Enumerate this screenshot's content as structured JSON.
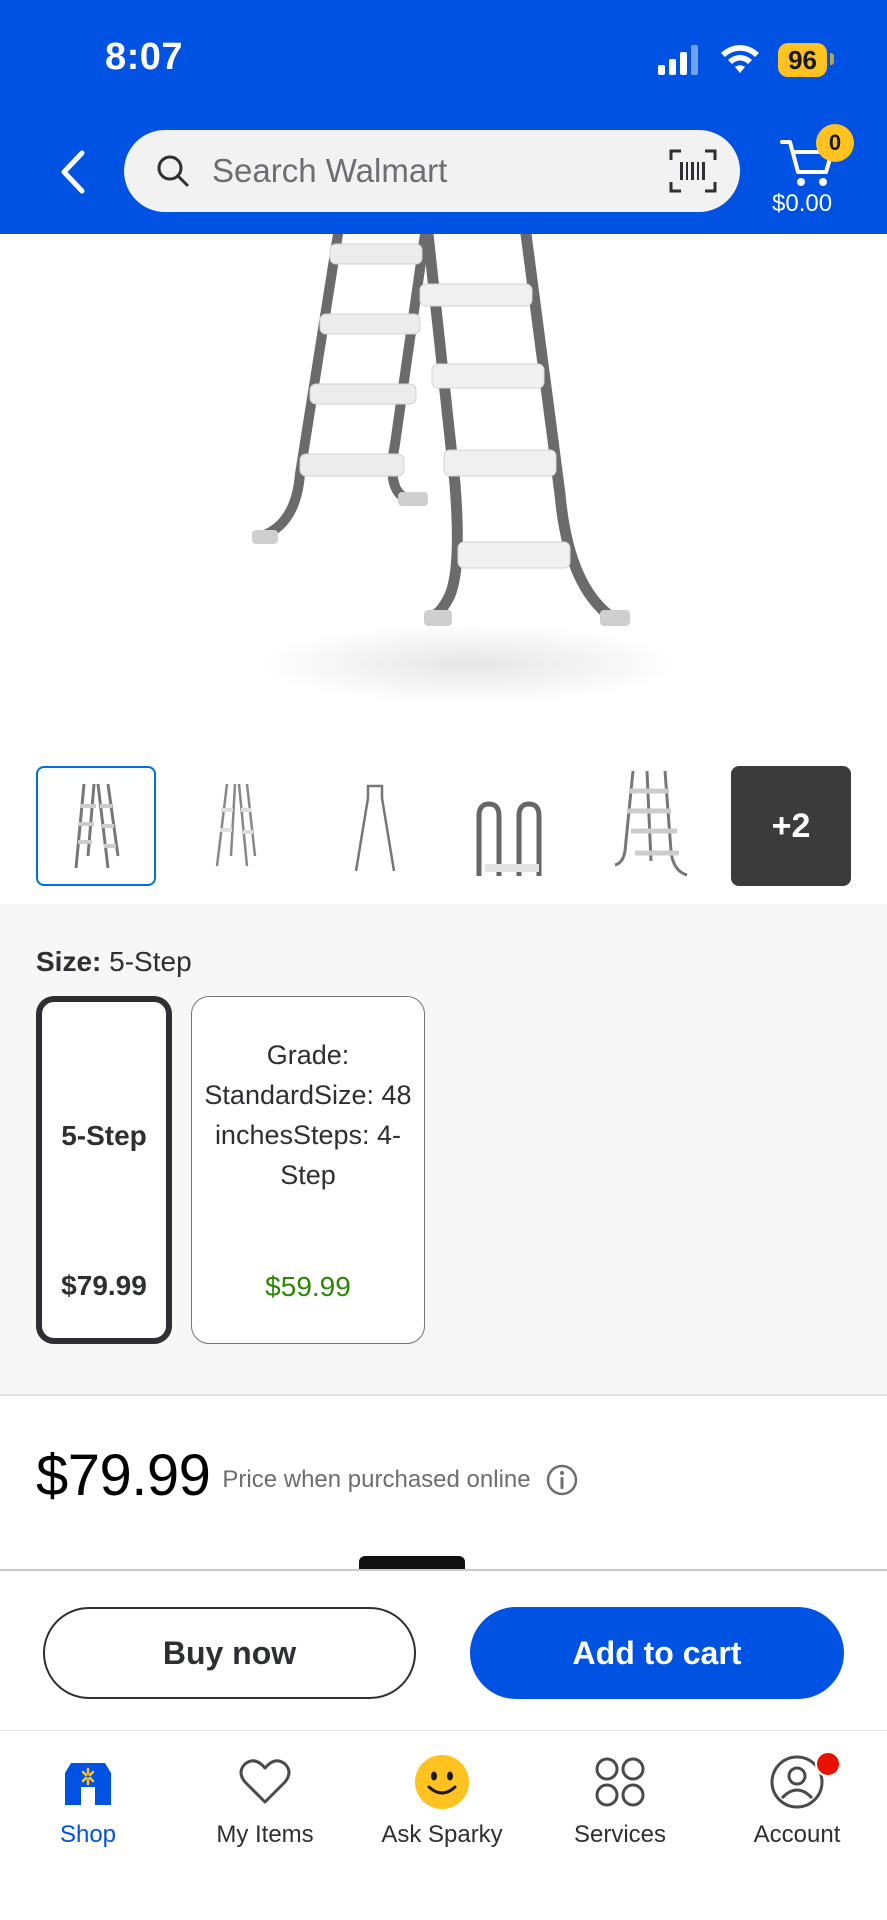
{
  "status_bar": {
    "time": "8:07",
    "battery": "96"
  },
  "header": {
    "search_placeholder": "Search Walmart",
    "cart_count": "0",
    "cart_total": "$0.00"
  },
  "gallery": {
    "more_label": "+2"
  },
  "size": {
    "label": "Size:",
    "selected_value": "5-Step",
    "options": [
      {
        "name": "5-Step",
        "price": "$79.99"
      },
      {
        "name": "Grade: StandardSize: 48 inchesSteps: 4-Step",
        "price": "$59.99"
      }
    ]
  },
  "price": {
    "amount": "$79.99",
    "note": "Price when purchased online"
  },
  "actions": {
    "buy_now": "Buy now",
    "add_to_cart": "Add to cart"
  },
  "nav": {
    "items": [
      {
        "label": "Shop"
      },
      {
        "label": "My Items"
      },
      {
        "label": "Ask Sparky"
      },
      {
        "label": "Services"
      },
      {
        "label": "Account"
      }
    ]
  },
  "colors": {
    "brand_blue": "#0053e2",
    "spark_yellow": "#ffc220",
    "sale_green": "#2a8703",
    "alert_red": "#ea1100"
  }
}
